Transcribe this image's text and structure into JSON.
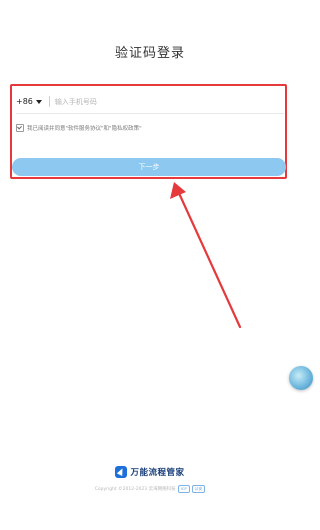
{
  "page": {
    "title": "验证码登录"
  },
  "form": {
    "country_code": "+86",
    "phone_placeholder": "输入手机号码",
    "phone_value": "",
    "agreement_text": "我已阅读并同意\"软件服务协议\"和\"隐私权政策\"",
    "next_label": "下一步"
  },
  "footer": {
    "logo_text": "万能流程管家",
    "copyright": "Copyright ©2012-2023 云海网络科技",
    "badge_1": "ICP",
    "badge_2": "公安"
  },
  "colors": {
    "highlight": "#e5393b",
    "button": "#8cc8f0",
    "brand": "#1e6fd9"
  },
  "icons": {
    "caret": "chevron-down-icon",
    "checkbox": "checkbox-icon",
    "float": "floating-assistant-icon",
    "logo": "app-logo-icon",
    "arrow": "annotation-arrow"
  }
}
